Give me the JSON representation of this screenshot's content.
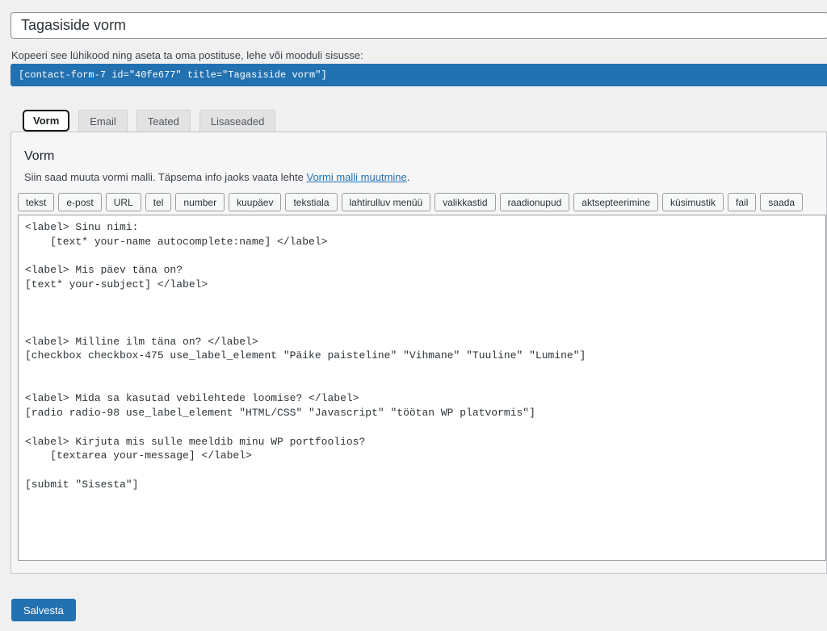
{
  "header": {
    "title_value": "Tagasiside vorm"
  },
  "shortcode": {
    "hint": "Kopeeri see lühikood ning aseta ta oma postituse, lehe või mooduli sisusse:",
    "code": "[contact-form-7 id=\"40fe677\" title=\"Tagasiside vorm\"]"
  },
  "tabs": [
    {
      "label": "Vorm",
      "active": true
    },
    {
      "label": "Email",
      "active": false
    },
    {
      "label": "Teated",
      "active": false
    },
    {
      "label": "Lisaseaded",
      "active": false
    }
  ],
  "panel": {
    "heading": "Vorm",
    "description": {
      "prefix": "Siin saad muuta vormi malli. Täpsema info jaoks vaata lehte ",
      "link_text": "Vormi malli muutmine",
      "suffix": "."
    },
    "tag_buttons": [
      "tekst",
      "e-post",
      "URL",
      "tel",
      "number",
      "kuupäev",
      "tekstiala",
      "lahtirulluv menüü",
      "valikkastid",
      "raadionupud",
      "aktsepteerimine",
      "küsimustik",
      "fail",
      "saada"
    ],
    "form_template": "<label> Sinu nimi:\n    [text* your-name autocomplete:name] </label>\n\n<label> Mis päev täna on?\n[text* your-subject] </label>\n\n\n\n<label> Milline ilm täna on? </label>\n[checkbox checkbox-475 use_label_element \"Päike paisteline\" \"Vihmane\" \"Tuuline\" \"Lumine\"]\n\n\n<label> Mida sa kasutad vebilehtede loomise? </label>\n[radio radio-98 use_label_element \"HTML/CSS\" \"Javascript\" \"töötan WP platvormis\"]\n\n<label> Kirjuta mis sulle meeldib minu WP portfoolios?\n    [textarea your-message] </label>\n\n[submit \"Sisesta\"]"
  },
  "actions": {
    "save_label": "Salvesta"
  },
  "colors": {
    "accent_blue": "#2271b1",
    "page_background": "#f0f0f1",
    "panel_background": "#f6f6f7"
  }
}
